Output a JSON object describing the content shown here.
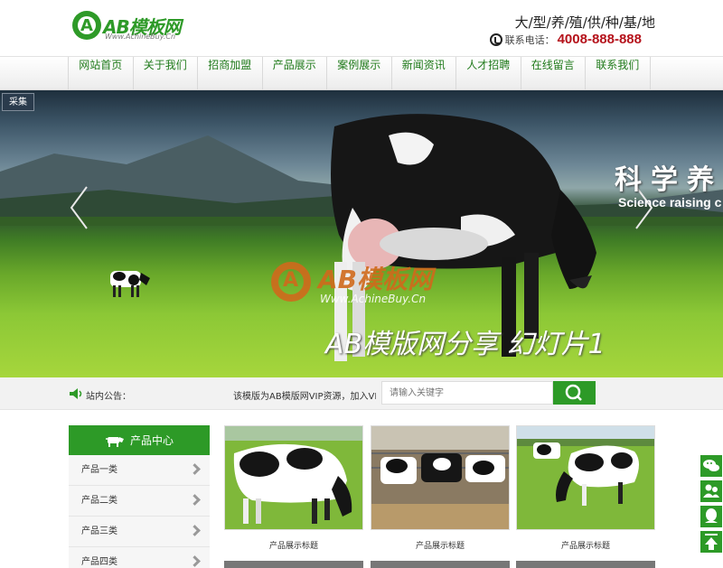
{
  "header": {
    "logo_text": "AB模板网",
    "logo_sub": "Www.AchineBuy.Cn",
    "slogan": "大/型/养/殖/供/种/基/地",
    "hotline_label": "联系电话：",
    "hotline_number": "4008-888-888"
  },
  "nav": [
    {
      "label": "网站首页"
    },
    {
      "label": "关于我们"
    },
    {
      "label": "招商加盟"
    },
    {
      "label": "产品展示"
    },
    {
      "label": "案例展示"
    },
    {
      "label": "新闻资讯"
    },
    {
      "label": "人才招聘"
    },
    {
      "label": "在线留言"
    },
    {
      "label": "联系我们"
    }
  ],
  "banner": {
    "tag": "采集",
    "headline": "科学养",
    "headline_en": "Science raising c",
    "watermark_text": "AB模板网",
    "watermark_sub": "Www.AchineBuy.Cn",
    "caption": "AB模版网分享 幻灯片1"
  },
  "notice": {
    "label": "站内公告：",
    "text": "该模版为AB模版网VIP资源，加入VIP后"
  },
  "search": {
    "placeholder": "请输入关键字"
  },
  "sidebar": {
    "title": "产品中心",
    "items": [
      {
        "label": "产品一类"
      },
      {
        "label": "产品二类"
      },
      {
        "label": "产品三类"
      },
      {
        "label": "产品四类"
      }
    ]
  },
  "products": [
    {
      "title": "产品展示标题"
    },
    {
      "title": "产品展示标题"
    },
    {
      "title": "产品展示标题"
    }
  ],
  "colors": {
    "brand_green": "#2d9a27",
    "nav_text": "#1f7a1a",
    "hotline_red": "#b5121b"
  },
  "floating_tools": [
    "wechat-icon",
    "contacts-icon",
    "qq-icon",
    "back-to-top-icon"
  ]
}
